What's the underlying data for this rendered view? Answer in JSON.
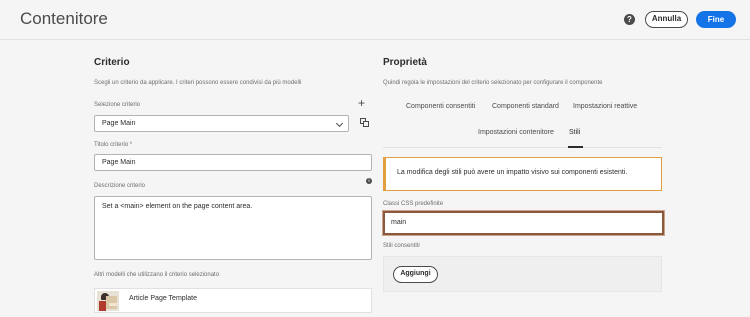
{
  "header": {
    "title": "Contenitore",
    "cancel_label": "Annulla",
    "done_label": "Fine",
    "help_icon": "help-icon",
    "accent_color": "#1473e6"
  },
  "policy": {
    "title": "Criterio",
    "description": "Scegli un criterio da applicare. I criteri possono essere condivisi da più modelli",
    "select_label": "Selezione criterio",
    "select_value": "Page Main",
    "title_label": "Titolo criterio *",
    "title_value": "Page Main",
    "desc_label": "Descrizione criterio",
    "desc_value": "Set a <main> element on the page content area.",
    "other_templates_label": "Altri modelli che utilizzano il criterio selezionato",
    "templates": [
      {
        "name": "Article Page Template"
      }
    ]
  },
  "properties": {
    "title": "Proprietà",
    "description": "Quindi regola le impostazioni del criterio selezionato per configurare il componente",
    "tabs": [
      {
        "label": "Componenti consentiti"
      },
      {
        "label": "Componenti standard"
      },
      {
        "label": "Impostazioni reattive"
      },
      {
        "label": "Impostazioni contenitore"
      },
      {
        "label": "Stili",
        "active": true
      }
    ],
    "alert_text": "La modifica degli stili può avere un impatto visivo sui componenti esistenti.",
    "alert_color": "#e0a040",
    "css_label": "Classi CSS predefinite",
    "css_value": "main",
    "allowed_styles_label": "Stili consentiti",
    "add_label": "Aggiungi"
  }
}
